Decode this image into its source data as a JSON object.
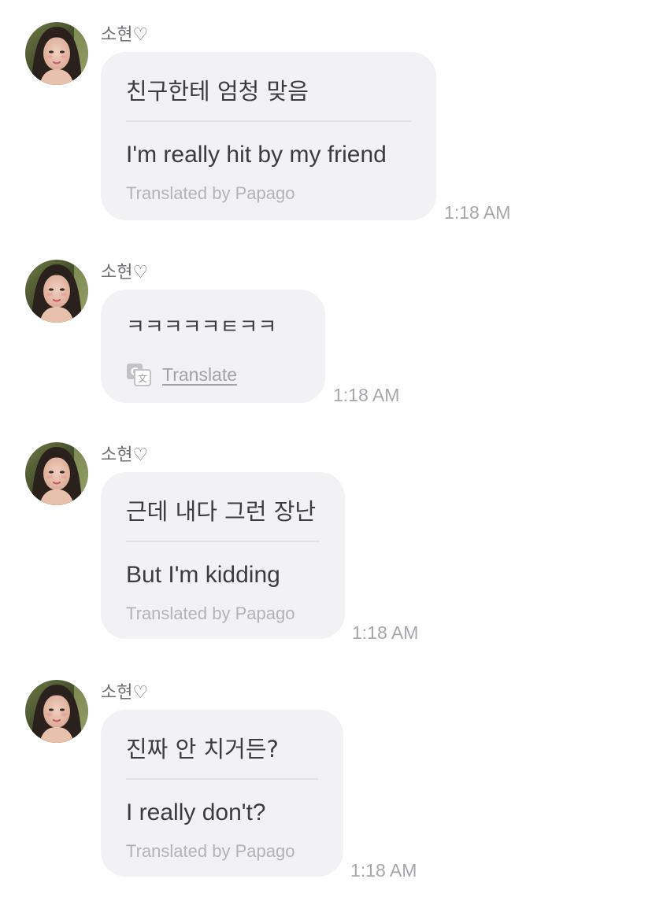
{
  "colors": {
    "bubble_bg": "#f2f2f5",
    "primary_text": "#3b3b40",
    "secondary_text": "#b3b3b8",
    "timestamp": "#a6a6ab"
  },
  "messages": [
    {
      "sender": "소현♡",
      "original": "친구한테 엄청 맞음",
      "translation": "I'm really hit by my friend",
      "credit": "Translated by Papago",
      "time": "1:18 AM"
    },
    {
      "sender": "소현♡",
      "original": "ㅋㅋㅋㅋㅋㅌㅋㅋ",
      "translate_action": "Translate",
      "translate_icon": "translate-icon",
      "time": "1:18 AM"
    },
    {
      "sender": "소현♡",
      "original": "근데 내다 그런 장난",
      "translation": "But I'm kidding",
      "credit": "Translated by Papago",
      "time": "1:18 AM"
    },
    {
      "sender": "소현♡",
      "original": "진짜 안 치거든?",
      "translation": "I really don't?",
      "credit": "Translated by Papago",
      "time": "1:18 AM"
    }
  ]
}
